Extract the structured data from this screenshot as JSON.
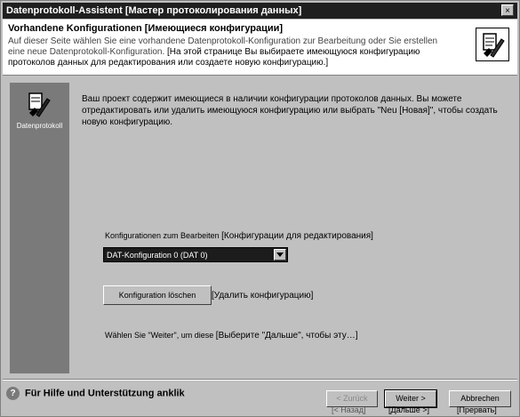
{
  "window": {
    "title": "Datenprotokoll-Assistent [Мастер протоколирования данных]",
    "close_glyph": "×"
  },
  "header": {
    "title": "Vorhandene Konfigurationen   [Имеющиеся конфигурации]",
    "desc_de": "Auf dieser Seite wählen Sie eine vorhandene Datenprotokoll-Konfiguration zur Bearbeitung oder Sie erstellen eine neue Datenprotokoll-Konfiguration.",
    "desc_ru": "[На этой странице Вы выбираете имеющуюся конфигурацию протоколов данных для редактирования или создаете новую конфигурацию.]",
    "icon": "datalog-wizard-icon"
  },
  "sidebar": {
    "label": "Datenprotokoll",
    "icon": "datalog-icon"
  },
  "main": {
    "description": "Ваш проект содержит имеющиеся в наличии конфигурации протоколов данных. Вы можете отредактировать или удалить имеющуюся конфигурацию или выбрать \"Neu [Новая]\", чтобы создать новую конфигурацию.",
    "config_label_de": "Konfigurationen zum Bearbeiten",
    "config_label_ru": "[Конфигурации для редактирования]",
    "config_selected": "DAT-Konfiguration 0 (DAT 0)",
    "delete_button": "Konfiguration löschen",
    "delete_ru": "[Удалить конфигурацию]",
    "hint_de": "Wählen Sie \"Weiter\", um diese",
    "hint_ru": "[Выберите \"Дальше\", чтобы эту…]"
  },
  "footer": {
    "help_text": "Für Hilfe und Unterstützung anklik",
    "back_label": "< Zurück",
    "back_ru": "[< Назад]",
    "next_label": "Weiter >",
    "next_ru": "[Дальше >]",
    "cancel_label": "Abbrechen",
    "cancel_ru": "[Прервать]"
  },
  "colors": {
    "titlebar": "#1f1f1f",
    "dialog_bg": "#c0c0c0",
    "sidebar_bg": "#7a7a7a",
    "selection": "#1c1c1c"
  }
}
